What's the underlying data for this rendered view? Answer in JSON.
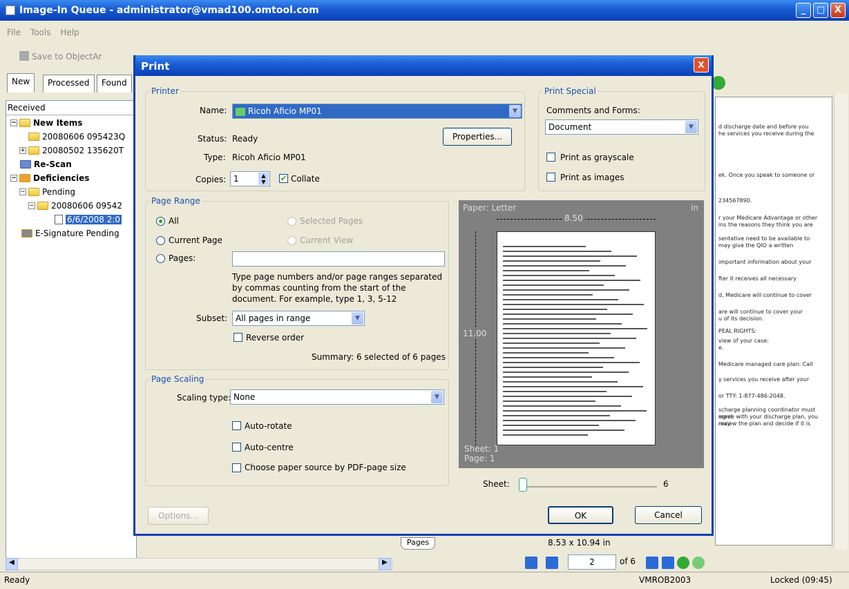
{
  "window": {
    "title": "Image-In Queue - administrator@vmad100.omtool.com",
    "min": "_",
    "max": "□",
    "close": "X"
  },
  "menu": [
    "File",
    "Tools",
    "Help"
  ],
  "toolbar": {
    "save": "Save to ObjectAr"
  },
  "tabs": [
    "New",
    "Processed",
    "Found"
  ],
  "tree": {
    "header": "Received",
    "new_items": "New Items",
    "item1": "20080606 095423Q",
    "item2": "20080502 135620T",
    "rescan": "Re-Scan",
    "deficiencies": "Deficiencies",
    "pending": "Pending",
    "item3": "20080606 09542",
    "item4": "6/6/2008 2:0",
    "esig": "E-Signature Pending"
  },
  "doc_text": [
    "d discharge date and before you",
    "he services you receive during the",
    "ek. Once you speak to someone or",
    "234567890.",
    "r your Medicare Advantage or other",
    "ins the reasons they think you are",
    "sentative need to be available to",
    "may give the QIO a written",
    "important information about your",
    "fter it receives all necessary",
    "d, Medicare will continue to cover",
    "are will continue to cover your",
    "u of its decision.",
    "PEAL RIGHTS:",
    "view of your case:",
    "e.",
    "Medicare managed care plan: Call",
    "y services you receive after your",
    "or TTY: 1-877-486-2048.",
    "scharge planning coordinator must meet",
    "agree with your discharge plan, you may",
    "review the plan and decide if it is"
  ],
  "bottom": {
    "pages_tab": "Pages",
    "page_size": "8.53 x 10.94 in",
    "page_num": "2",
    "of_pages": "of 6"
  },
  "status": {
    "left": "Ready",
    "computer": "VMROB2003",
    "lock": "Locked (09:45)"
  },
  "dialog": {
    "title": "Print",
    "close": "X",
    "printer": {
      "group": "Printer",
      "name_label": "Name:",
      "name": "Ricoh Aficio MP01",
      "status_label": "Status:",
      "status": "Ready",
      "type_label": "Type:",
      "type": "Ricoh Aficio MP01",
      "copies_label": "Copies:",
      "copies": "1",
      "collate": "Collate",
      "properties": "Properties..."
    },
    "special": {
      "group": "Print Special",
      "comments_label": "Comments and Forms:",
      "comments": "Document",
      "grayscale": "Print as grayscale",
      "images": "Print as images"
    },
    "range": {
      "group": "Page Range",
      "all": "All",
      "current_page": "Current Page",
      "pages": "Pages:",
      "selected": "Selected Pages",
      "current_view": "Current View",
      "hint": "Type page numbers and/or page ranges separated by commas counting from the start of the document. For example, type 1, 3, 5-12",
      "subset_label": "Subset:",
      "subset": "All pages in range",
      "reverse": "Reverse order",
      "summary": "Summary: 6 selected of 6 pages"
    },
    "scaling": {
      "group": "Page Scaling",
      "type_label": "Scaling type:",
      "type": "None",
      "autorotate": "Auto-rotate",
      "autocentre": "Auto-centre",
      "papersource": "Choose paper source by PDF-page size"
    },
    "preview": {
      "paper": "Paper: Letter",
      "unit": "in",
      "width": "8.50",
      "height": "11.00",
      "sheet": "Sheet: 1",
      "page": "Page: 1"
    },
    "sheet": {
      "label": "Sheet:",
      "max": "6"
    },
    "buttons": {
      "options": "Options...",
      "ok": "OK",
      "cancel": "Cancel"
    }
  }
}
